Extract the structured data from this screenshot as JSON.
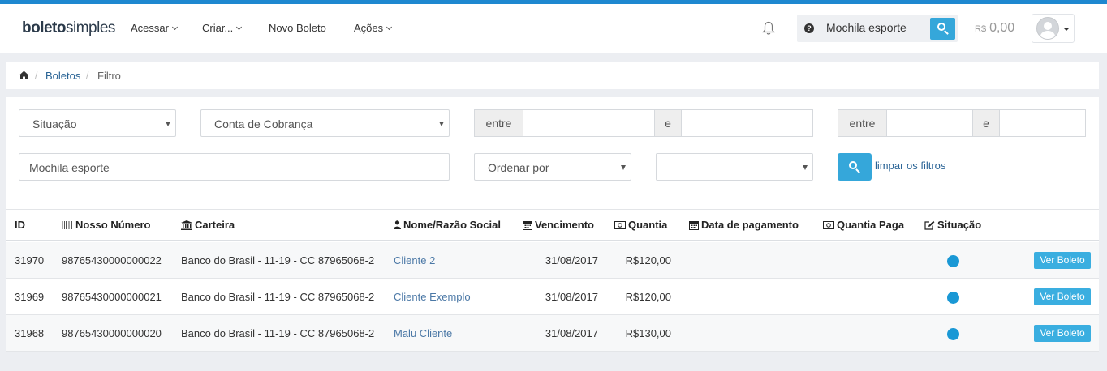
{
  "navbar": {
    "logo_bold": "boleto",
    "logo_rest": "simples",
    "menu": [
      {
        "label": "Acessar"
      },
      {
        "label": "Criar..."
      },
      {
        "label": "Novo Boleto"
      },
      {
        "label": "Ações"
      }
    ],
    "search_value": "Mochila esporte",
    "search_help": "?",
    "balance_currency": "R$",
    "balance_value": "0,00"
  },
  "breadcrumb": {
    "sep": "/",
    "link": "Boletos",
    "current": "Filtro"
  },
  "filters": {
    "situacao": "Situação",
    "conta": "Conta de Cobrança",
    "range1_start_addon": "entre",
    "range1_mid_addon": "e",
    "range2_start_addon": "entre",
    "range2_mid_addon": "e",
    "query": "Mochila esporte",
    "ordenar": "Ordenar por",
    "clear_label": "limpar os filtros"
  },
  "table": {
    "headers": {
      "id": "ID",
      "nosso_numero": "Nosso Número",
      "carteira": "Carteira",
      "nome": "Nome/Razão Social",
      "vencimento": "Vencimento",
      "quantia": "Quantia",
      "data_pagamento": "Data de pagamento",
      "quantia_paga": "Quantia Paga",
      "situacao": "Situação"
    },
    "rows": [
      {
        "id": "31970",
        "nosso_numero": "98765430000000022",
        "carteira": "Banco do Brasil - 11-19 - CC 87965068-2",
        "nome": "Cliente 2",
        "vencimento": "31/08/2017",
        "quantia": "R$120,00",
        "action": "Ver Boleto"
      },
      {
        "id": "31969",
        "nosso_numero": "98765430000000021",
        "carteira": "Banco do Brasil - 11-19 - CC 87965068-2",
        "nome": "Cliente Exemplo",
        "vencimento": "31/08/2017",
        "quantia": "R$120,00",
        "action": "Ver Boleto"
      },
      {
        "id": "31968",
        "nosso_numero": "98765430000000020",
        "carteira": "Banco do Brasil - 11-19 - CC 87965068-2",
        "nome": "Malu Cliente",
        "vencimento": "31/08/2017",
        "quantia": "R$130,00",
        "action": "Ver Boleto"
      }
    ]
  },
  "colors": {
    "accent": "#35a7da",
    "top_border": "#1e88d0",
    "status_dot": "#1a98d5"
  }
}
